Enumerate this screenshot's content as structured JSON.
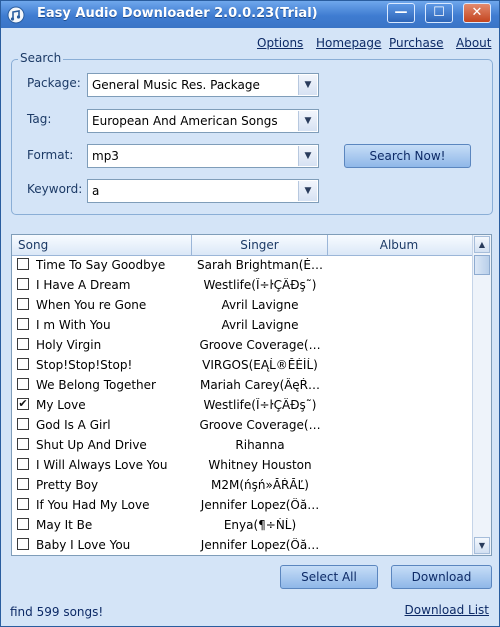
{
  "window": {
    "title": "Easy Audio Downloader 2.0.0.23(Trial)",
    "controls": {
      "minimize": "—",
      "maximize": "☐",
      "close": "✕"
    }
  },
  "menu": {
    "options": "Options",
    "homepage": "Homepage",
    "purchase": "Purchase",
    "about": "About"
  },
  "search": {
    "legend": "Search",
    "package": {
      "label": "Package:",
      "value": "General Music Res. Package"
    },
    "tag": {
      "label": "Tag:",
      "value": "European And American Songs"
    },
    "format": {
      "label": "Format:",
      "value": "mp3"
    },
    "keyword": {
      "label": "Keyword:",
      "value": "a"
    },
    "search_button": "Search Now!"
  },
  "list": {
    "columns": {
      "song": "Song",
      "singer": "Singer",
      "album": "Album"
    },
    "rows": [
      {
        "song": "Time To Say Goodbye",
        "singer": "Sarah Brightman(É…",
        "album": "",
        "checked": false
      },
      {
        "song": "I Have A Dream",
        "singer": "Westlife(Î÷ŀÇÄĐş˜)",
        "album": "",
        "checked": false
      },
      {
        "song": "When You re Gone",
        "singer": "Avril Lavigne",
        "album": "",
        "checked": false
      },
      {
        "song": "I m With You",
        "singer": "Avril Lavigne",
        "album": "",
        "checked": false
      },
      {
        "song": "Holy Virgin",
        "singer": "Groove Coverage(…",
        "album": "",
        "checked": false
      },
      {
        "song": "Stop!Stop!Stop!",
        "singer": "VIRGOS(ЕĄĹ®ĔĖÍĹ)",
        "album": "",
        "checked": false
      },
      {
        "song": "We Belong Together",
        "singer": "Mariah Carey(ÂęŔ…",
        "album": "",
        "checked": false
      },
      {
        "song": "My Love",
        "singer": "Westlife(Î÷ŀÇÄĐş˜)",
        "album": "",
        "checked": true
      },
      {
        "song": "God Is A Girl",
        "singer": "Groove Coverage(…",
        "album": "",
        "checked": false
      },
      {
        "song": "Shut Up And Drive",
        "singer": "Rihanna",
        "album": "",
        "checked": false
      },
      {
        "song": "I Will Always Love You",
        "singer": "Whitney Houston",
        "album": "",
        "checked": false
      },
      {
        "song": "Pretty Boy",
        "singer": "M2M(ńşń»ĂŔĂĽ)",
        "album": "",
        "checked": false
      },
      {
        "song": "If You Had My Love",
        "singer": "Jennifer Lopez(Öă…",
        "album": "",
        "checked": false
      },
      {
        "song": "May It Be",
        "singer": "Enya(¶÷ŃĹ)",
        "album": "",
        "checked": false
      },
      {
        "song": "Baby I Love You",
        "singer": "Jennifer Lopez(Öă…",
        "album": "",
        "checked": false
      }
    ]
  },
  "actions": {
    "select_all": "Select All",
    "download": "Download"
  },
  "status": {
    "text": "find 599 songs!",
    "download_list": "Download List"
  },
  "colors": {
    "titlebar": "#3f7cd1",
    "window_bg": "#d4e4f7",
    "link": "#0d2a66"
  }
}
